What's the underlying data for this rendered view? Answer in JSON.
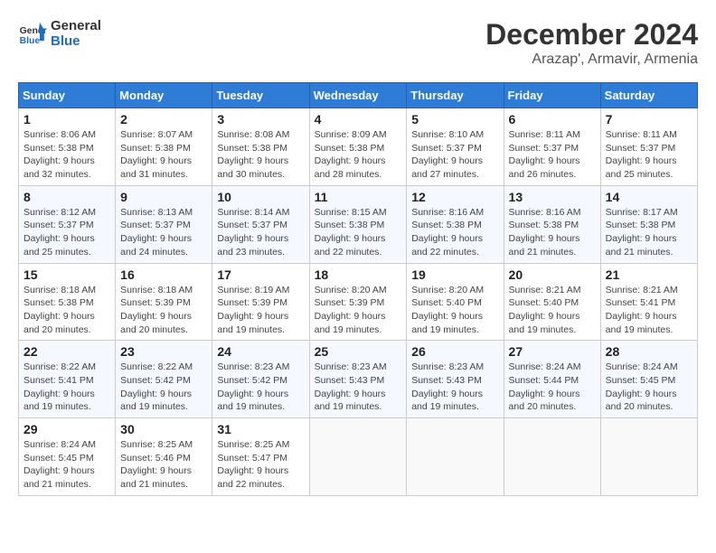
{
  "logo": {
    "line1": "General",
    "line2": "Blue"
  },
  "title": "December 2024",
  "subtitle": "Arazap', Armavir, Armenia",
  "weekdays": [
    "Sunday",
    "Monday",
    "Tuesday",
    "Wednesday",
    "Thursday",
    "Friday",
    "Saturday"
  ],
  "weeks": [
    [
      {
        "day": "1",
        "sunrise": "8:06 AM",
        "sunset": "5:38 PM",
        "daylight": "9 hours and 32 minutes."
      },
      {
        "day": "2",
        "sunrise": "8:07 AM",
        "sunset": "5:38 PM",
        "daylight": "9 hours and 31 minutes."
      },
      {
        "day": "3",
        "sunrise": "8:08 AM",
        "sunset": "5:38 PM",
        "daylight": "9 hours and 30 minutes."
      },
      {
        "day": "4",
        "sunrise": "8:09 AM",
        "sunset": "5:38 PM",
        "daylight": "9 hours and 28 minutes."
      },
      {
        "day": "5",
        "sunrise": "8:10 AM",
        "sunset": "5:37 PM",
        "daylight": "9 hours and 27 minutes."
      },
      {
        "day": "6",
        "sunrise": "8:11 AM",
        "sunset": "5:37 PM",
        "daylight": "9 hours and 26 minutes."
      },
      {
        "day": "7",
        "sunrise": "8:11 AM",
        "sunset": "5:37 PM",
        "daylight": "9 hours and 25 minutes."
      }
    ],
    [
      {
        "day": "8",
        "sunrise": "8:12 AM",
        "sunset": "5:37 PM",
        "daylight": "9 hours and 25 minutes."
      },
      {
        "day": "9",
        "sunrise": "8:13 AM",
        "sunset": "5:37 PM",
        "daylight": "9 hours and 24 minutes."
      },
      {
        "day": "10",
        "sunrise": "8:14 AM",
        "sunset": "5:37 PM",
        "daylight": "9 hours and 23 minutes."
      },
      {
        "day": "11",
        "sunrise": "8:15 AM",
        "sunset": "5:38 PM",
        "daylight": "9 hours and 22 minutes."
      },
      {
        "day": "12",
        "sunrise": "8:16 AM",
        "sunset": "5:38 PM",
        "daylight": "9 hours and 22 minutes."
      },
      {
        "day": "13",
        "sunrise": "8:16 AM",
        "sunset": "5:38 PM",
        "daylight": "9 hours and 21 minutes."
      },
      {
        "day": "14",
        "sunrise": "8:17 AM",
        "sunset": "5:38 PM",
        "daylight": "9 hours and 21 minutes."
      }
    ],
    [
      {
        "day": "15",
        "sunrise": "8:18 AM",
        "sunset": "5:38 PM",
        "daylight": "9 hours and 20 minutes."
      },
      {
        "day": "16",
        "sunrise": "8:18 AM",
        "sunset": "5:39 PM",
        "daylight": "9 hours and 20 minutes."
      },
      {
        "day": "17",
        "sunrise": "8:19 AM",
        "sunset": "5:39 PM",
        "daylight": "9 hours and 19 minutes."
      },
      {
        "day": "18",
        "sunrise": "8:20 AM",
        "sunset": "5:39 PM",
        "daylight": "9 hours and 19 minutes."
      },
      {
        "day": "19",
        "sunrise": "8:20 AM",
        "sunset": "5:40 PM",
        "daylight": "9 hours and 19 minutes."
      },
      {
        "day": "20",
        "sunrise": "8:21 AM",
        "sunset": "5:40 PM",
        "daylight": "9 hours and 19 minutes."
      },
      {
        "day": "21",
        "sunrise": "8:21 AM",
        "sunset": "5:41 PM",
        "daylight": "9 hours and 19 minutes."
      }
    ],
    [
      {
        "day": "22",
        "sunrise": "8:22 AM",
        "sunset": "5:41 PM",
        "daylight": "9 hours and 19 minutes."
      },
      {
        "day": "23",
        "sunrise": "8:22 AM",
        "sunset": "5:42 PM",
        "daylight": "9 hours and 19 minutes."
      },
      {
        "day": "24",
        "sunrise": "8:23 AM",
        "sunset": "5:42 PM",
        "daylight": "9 hours and 19 minutes."
      },
      {
        "day": "25",
        "sunrise": "8:23 AM",
        "sunset": "5:43 PM",
        "daylight": "9 hours and 19 minutes."
      },
      {
        "day": "26",
        "sunrise": "8:23 AM",
        "sunset": "5:43 PM",
        "daylight": "9 hours and 19 minutes."
      },
      {
        "day": "27",
        "sunrise": "8:24 AM",
        "sunset": "5:44 PM",
        "daylight": "9 hours and 20 minutes."
      },
      {
        "day": "28",
        "sunrise": "8:24 AM",
        "sunset": "5:45 PM",
        "daylight": "9 hours and 20 minutes."
      }
    ],
    [
      {
        "day": "29",
        "sunrise": "8:24 AM",
        "sunset": "5:45 PM",
        "daylight": "9 hours and 21 minutes."
      },
      {
        "day": "30",
        "sunrise": "8:25 AM",
        "sunset": "5:46 PM",
        "daylight": "9 hours and 21 minutes."
      },
      {
        "day": "31",
        "sunrise": "8:25 AM",
        "sunset": "5:47 PM",
        "daylight": "9 hours and 22 minutes."
      },
      null,
      null,
      null,
      null
    ]
  ]
}
